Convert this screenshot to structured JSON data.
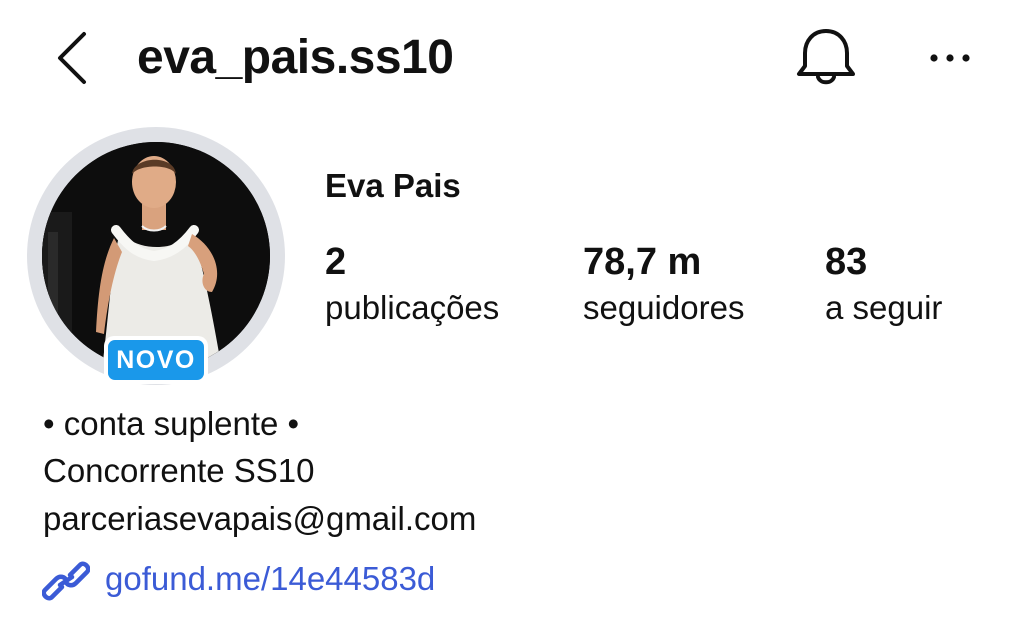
{
  "header": {
    "username": "eva_pais.ss10",
    "back_icon": "chevron-left-icon",
    "bell_icon": "bell-icon",
    "more_icon": "more-horizontal-icon"
  },
  "profile": {
    "badge": "NOVO",
    "badge_color": "#1a98ea",
    "display_name": "Eva Pais",
    "stats": [
      {
        "value": "2",
        "label": "publicações"
      },
      {
        "value": "78,7 m",
        "label": "seguidores"
      },
      {
        "value": "83",
        "label": "a seguir"
      }
    ]
  },
  "bio": {
    "lines": [
      "• conta suplente •",
      "Concorrente SS10",
      "parceriasevapais@gmail.com"
    ],
    "link": "gofund.me/14e44583d",
    "link_icon": "link-icon",
    "link_color": "#3b5bd6"
  }
}
